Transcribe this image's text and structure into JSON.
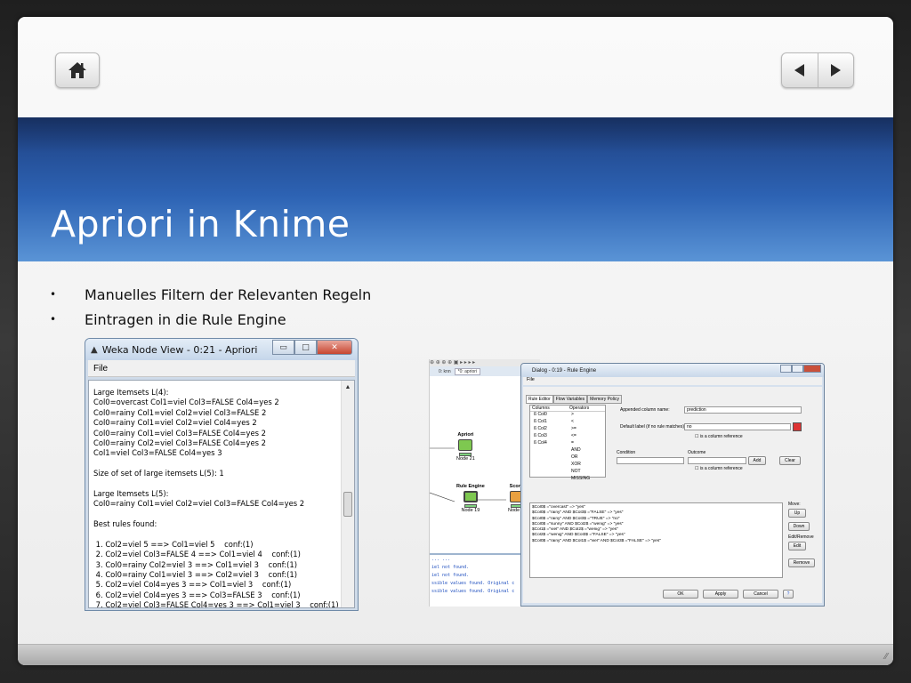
{
  "slide": {
    "title": "Apriori in Knime",
    "bullets": [
      "Manuelles Filtern der Relevanten Regeln",
      "Eintragen in die Rule Engine"
    ]
  },
  "navigation": {
    "home_icon": "home-icon",
    "prev_icon": "triangle-left-icon",
    "next_icon": "triangle-right-icon"
  },
  "weka_window": {
    "title": "Weka Node View - 0:21 - Apriori",
    "menu_file": "File",
    "lines": [
      "Large Itemsets L(4):",
      "Col0=overcast Col1=viel Col3=FALSE Col4=yes 2",
      "Col0=rainy Col1=viel Col2=viel Col3=FALSE 2",
      "Col0=rainy Col1=viel Col2=viel Col4=yes 2",
      "Col0=rainy Col1=viel Col3=FALSE Col4=yes 2",
      "Col0=rainy Col2=viel Col3=FALSE Col4=yes 2",
      "Col1=viel Col3=FALSE Col4=yes 3",
      "",
      "Size of set of large itemsets L(5): 1",
      "",
      "Large Itemsets L(5):",
      "Col0=rainy Col1=viel Col2=viel Col3=FALSE Col4=yes 2",
      "",
      "Best rules found:",
      "",
      " 1. Col2=viel 5 ==> Col1=viel 5    conf:(1)",
      " 2. Col2=viel Col3=FALSE 4 ==> Col1=viel 4    conf:(1)",
      " 3. Col0=rainy Col2=viel 3 ==> Col1=viel 3    conf:(1)",
      " 4. Col0=rainy Col1=viel 3 ==> Col2=viel 3    conf:(1)",
      " 5. Col2=viel Col4=yes 3 ==> Col1=viel 3    conf:(1)",
      " 6. Col2=viel Col4=yes 3 ==> Col3=FALSE 3    conf:(1)",
      " 7. Col2=viel Col3=FALSE Col4=yes 3 ==> Col1=viel 3    conf:(1)"
    ]
  },
  "knime_editor": {
    "tabs": [
      "0: knn",
      "*0: apriori"
    ],
    "nodes": [
      {
        "label": "Apriori",
        "id": "Node 21"
      },
      {
        "label": "Rule Engine",
        "id": "Node 19"
      },
      {
        "label": "Scorer",
        "id": "Node 22"
      }
    ],
    "console_lines": [
      "...  ...",
      "iel not found.",
      "iel not found.",
      "ssible values found. Original c",
      "ssible values found. Original c"
    ]
  },
  "rule_dialog": {
    "title": "Dialog - 0:19 - Rule Engine",
    "menu_file": "File",
    "tabs": [
      "Rule Editor",
      "Flow Variables",
      "Memory Policy"
    ],
    "columns_header": "Columns",
    "operators_header": "Operators",
    "columns": [
      "Col0",
      "Col1",
      "Col2",
      "Col3",
      "Col4"
    ],
    "operators": [
      ">",
      "<",
      ">=",
      "<=",
      "=",
      "AND",
      "OR",
      "XOR",
      "NOT",
      "MISSING"
    ],
    "appended_label": "Appended column name:",
    "appended_value": "prediction",
    "default_label": "Default label (if no rule matches):",
    "default_value": "no",
    "column_ref": "is a column reference",
    "condition_label": "Condition",
    "outcome_label": "Outcome",
    "add_button": "Add",
    "clear_button": "Clear",
    "rules": [
      "$Col0$ =\"overcast\" => \"yes\"",
      "$Col0$ =\"rainy\" AND $Col3$ =\"FALSE\" => \"yes\"",
      "$Col0$ =\"rainy\" AND $Col3$ =\"TRUE\" => \"no\"",
      "$Col0$ =\"sunny\" AND $Col2$ =\"wenig\" => \"yes\"",
      "$Col1$ =\"viel\" AND $Col2$ =\"wenig\" => \"yes\"",
      "$Col2$ =\"wenig\" AND $Col3$ =\"FALSE\" => \"yes\"",
      "$Col0$ =\"rainy\" AND $Col1$ =\"viel\" AND $Col3$ =\"FALSE\" => \"yes\""
    ],
    "move_label": "Move:",
    "up_button": "Up",
    "down_button": "Down",
    "edit_remove_label": "Edit/Remove",
    "edit_button": "Edit",
    "remove_button": "Remove",
    "ok_button": "OK",
    "apply_button": "Apply",
    "cancel_button": "Cancel",
    "help_button": "?"
  }
}
